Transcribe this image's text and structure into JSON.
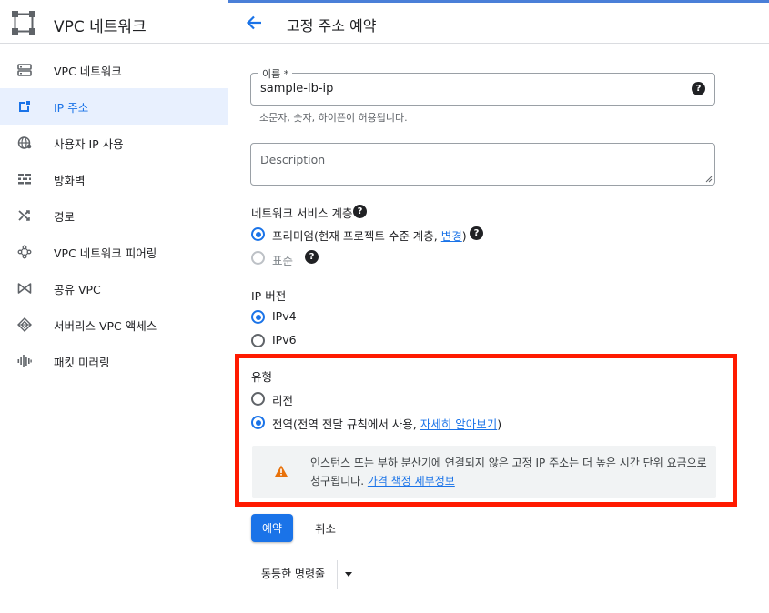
{
  "sidebar": {
    "title": "VPC 네트워크",
    "items": [
      {
        "label": "VPC 네트워크",
        "icon": "vpc-network-icon"
      },
      {
        "label": "IP 주소",
        "icon": "ip-address-icon",
        "active": true
      },
      {
        "label": "사용자 IP 사용",
        "icon": "globe-icon"
      },
      {
        "label": "방화벽",
        "icon": "firewall-icon"
      },
      {
        "label": "경로",
        "icon": "routes-icon"
      },
      {
        "label": "VPC 네트워크 피어링",
        "icon": "peering-icon"
      },
      {
        "label": "공유 VPC",
        "icon": "shared-vpc-icon"
      },
      {
        "label": "서버리스 VPC 액세스",
        "icon": "serverless-icon"
      },
      {
        "label": "패킷 미러링",
        "icon": "packet-mirroring-icon"
      }
    ]
  },
  "header": {
    "title": "고정 주소 예약"
  },
  "form": {
    "name": {
      "label": "이름 *",
      "value": "sample-lb-ip",
      "hint": "소문자, 숫자, 하이픈이 허용됩니다."
    },
    "description": {
      "placeholder": "Description"
    },
    "tier": {
      "title": "네트워크 서비스 계층",
      "premium_text": "프리미엄(현재 프로젝트 수준 계층, ",
      "premium_link": "변경",
      "premium_close": ")",
      "standard": "표준"
    },
    "ip_version": {
      "title": "IP 버전",
      "ipv4": "IPv4",
      "ipv6": "IPv6"
    },
    "type": {
      "title": "유형",
      "regional": "리전",
      "global_text": "전역(전역 전달 규칙에서 사용, ",
      "global_link": "자세히 알아보기",
      "global_close": ")"
    },
    "warning": {
      "text": "인스턴스 또는 부하 분산기에 연결되지 않은 고정 IP 주소는 더 높은 시간 단위 요금으로 청구됩니다. ",
      "link": "가격 책정 세부정보"
    }
  },
  "actions": {
    "reserve": "예약",
    "cancel": "취소",
    "equivalent_cmd": "동등한 명령줄"
  },
  "colors": {
    "accent": "#1a73e8",
    "highlight": "#ff1a00",
    "warning": "#e8710a"
  }
}
